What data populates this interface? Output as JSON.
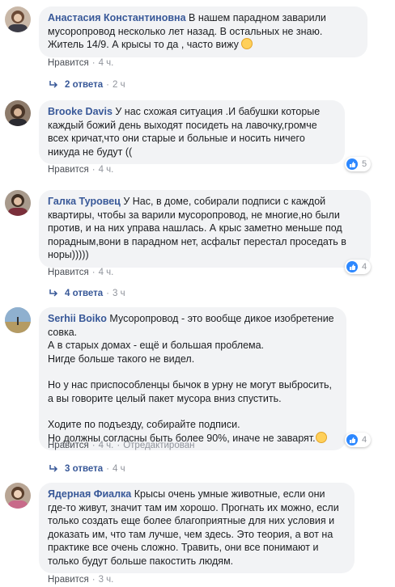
{
  "comments": [
    {
      "name": "Анастасия Константиновна",
      "paragraphs": [
        "В нашем парадном заварили мусоропровод несколько лет назад. В остальных не знаю. Житель 14/9. А крысы то да , часто вижу"
      ],
      "like_label": "Нравится",
      "time": "4 ч.",
      "replies": {
        "label": "2 ответа",
        "time": "2 ч"
      }
    },
    {
      "name": "Brooke Davis",
      "paragraphs": [
        "У нас схожая ситуация .И бабушки которые каждый божий день выходят посидеть на лавочку,громче всех кричат,что они старые и больные и носить ничего никуда не будут (("
      ],
      "like_label": "Нравится",
      "time": "4 ч.",
      "reactions": "5"
    },
    {
      "name": "Галка Туровец",
      "paragraphs": [
        "У Нас, в доме, собирали подписи с каждой квартиры, чтобы за варили мусоропровод, не многие,но были против, и на них управа нашлась. А крыс заметно меньше под порадным,вони в парадном нет, асфальт перестал проседать в норы)))))"
      ],
      "like_label": "Нравится",
      "time": "4 ч.",
      "reactions": "4",
      "replies": {
        "label": "4 ответа",
        "time": "3 ч"
      }
    },
    {
      "name": "Serhii Boiko",
      "paragraphs": [
        "Мусоропровод - это вообще дикое изобретение совка.\nА в старых домах - ещё и большая проблема.\nНигде больше такого не видел.",
        "Но у нас приспособленцы бычок в урну не могут выбросить, а вы говорите целый пакет мусора вниз спустить.",
        "Ходите по подъезду, собирайте подписи.\nНо должны согласны быть более 90%, иначе не заварят."
      ],
      "like_label": "Нравится",
      "time": "4 ч.",
      "edited": "Отредактирован",
      "reactions": "4",
      "replies": {
        "label": "3 ответа",
        "time": "4 ч"
      }
    },
    {
      "name": "Ядерная Фиалка",
      "paragraphs": [
        "Крысы очень умные животные, если они где-то живут, значит там им хорошо. Прогнать их можно, если только создать еще более благоприятные для них условия и доказать им, что там лучше, чем здесь. Это теория, а вот на практике все очень сложно. Травить, они все понимают и только будут больше пакостить людям."
      ],
      "like_label": "Нравится",
      "time": "3 ч."
    }
  ]
}
